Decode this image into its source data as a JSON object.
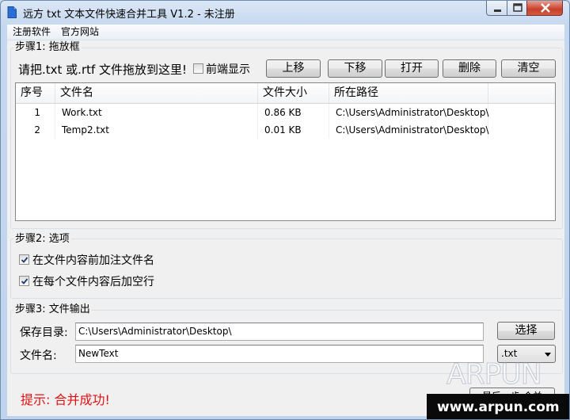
{
  "window": {
    "title": "远方 txt 文本文件快速合并工具 V1.2 - 未注册"
  },
  "menu": {
    "items": [
      "注册软件",
      "官方网站"
    ]
  },
  "step1": {
    "legend": "步骤1: 拖放框",
    "hint": "请把.txt 或.rtf 文件拖放到这里!",
    "front_display_label": "前端显示",
    "front_display_checked": false,
    "buttons": {
      "up": "上移",
      "down": "下移",
      "open": "打开",
      "delete": "删除",
      "clear": "清空"
    },
    "columns": [
      "序号",
      "文件名",
      "文件大小",
      "所在路径"
    ],
    "rows": [
      {
        "index": "1",
        "name": "Work.txt",
        "size": "0.86 KB",
        "path": "C:\\Users\\Administrator\\Desktop\\"
      },
      {
        "index": "2",
        "name": "Temp2.txt",
        "size": "0.01 KB",
        "path": "C:\\Users\\Administrator\\Desktop\\"
      }
    ]
  },
  "step2": {
    "legend": "步骤2: 选项",
    "opt_prefix_label": "在文件内容前加注文件名",
    "opt_prefix_checked": true,
    "opt_blank_label": "在每个文件内容后加空行",
    "opt_blank_checked": true
  },
  "step3": {
    "legend": "步骤3: 文件输出",
    "save_dir_label": "保存目录:",
    "save_dir_value": "C:\\Users\\Administrator\\Desktop\\",
    "choose_button": "选择",
    "filename_label": "文件名:",
    "filename_value": "NewText",
    "ext_selected": ".txt",
    "merge_button": "最后一步:合并"
  },
  "status": {
    "message": "提示: 合并成功!"
  },
  "watermark": {
    "logo": "ARPUN",
    "url": "www.arpun.com"
  },
  "colors": {
    "status_red": "#e01010",
    "accent_blue": "#1a6fd1"
  }
}
